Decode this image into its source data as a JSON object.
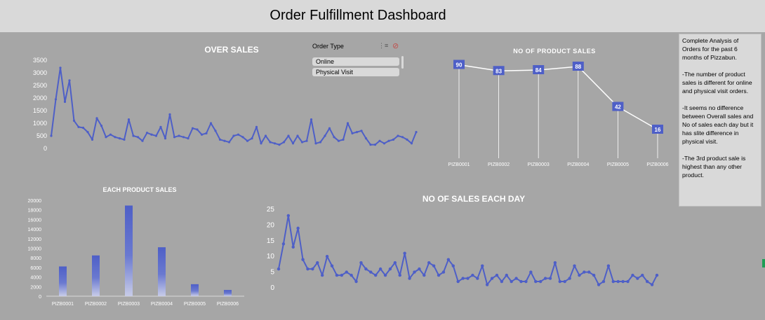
{
  "dashboard": {
    "title": "Order Fulfillment Dashboard"
  },
  "slicer": {
    "header": "Order Type",
    "items": [
      "Online",
      "Physical Visit"
    ]
  },
  "insights": [
    "Complete Analysis of Orders for the past 6 months of Pizzabun.",
    "-The number of product sales is different for online and physical visit orders.",
    "-It seems no difference between Overall sales and No of sales each day but it has slite difference in physical visit.",
    "-The 3rd product sale is highest than any other product."
  ],
  "colors": {
    "series": "#4e5fc7",
    "background": "#a6a6a6",
    "header": "#d9d9d9"
  },
  "chart_data": [
    {
      "id": "over_sales",
      "type": "line",
      "title": "OVER SALES",
      "ylim": [
        0,
        3500
      ],
      "yticks": [
        0,
        500,
        1000,
        1500,
        2000,
        2500,
        3000,
        3500
      ],
      "grid": false,
      "values": [
        500,
        1950,
        3200,
        1850,
        2700,
        1100,
        850,
        820,
        650,
        350,
        1200,
        900,
        450,
        550,
        450,
        400,
        350,
        1150,
        500,
        450,
        300,
        620,
        550,
        500,
        850,
        400,
        1350,
        450,
        500,
        450,
        400,
        800,
        750,
        550,
        600,
        1000,
        700,
        350,
        300,
        250,
        500,
        550,
        450,
        300,
        400,
        850,
        200,
        500,
        250,
        200,
        150,
        250,
        500,
        200,
        500,
        250,
        300,
        1150,
        200,
        250,
        500,
        800,
        450,
        300,
        350,
        1000,
        600,
        650,
        700,
        400,
        150,
        150,
        300,
        200,
        300,
        350,
        500,
        450,
        350,
        200,
        650
      ]
    },
    {
      "id": "no_of_product_sales",
      "type": "line",
      "title": "NO OF PRODUCT SALES",
      "categories": [
        "PIZB0001",
        "PIZB0002",
        "PIZB0003",
        "PIZB0004",
        "PIZB0005",
        "PIZB0006"
      ],
      "values": [
        90,
        83,
        84,
        88,
        42,
        16
      ],
      "ylim": [
        0,
        100
      ]
    },
    {
      "id": "each_product_sales",
      "type": "bar",
      "title": "EACH PRODUCT SALES",
      "categories": [
        "PIZB0001",
        "PIZB0002",
        "PIZB0003",
        "PIZB0004",
        "PIZB0005",
        "PIZB0006"
      ],
      "values": [
        6200,
        8500,
        18900,
        10200,
        2500,
        1300
      ],
      "ylim": [
        0,
        20000
      ],
      "yticks": [
        0,
        2000,
        4000,
        6000,
        8000,
        10000,
        12000,
        14000,
        16000,
        18000,
        20000
      ]
    },
    {
      "id": "no_of_sales_each_day",
      "type": "line",
      "title": "NO OF SALES EACH DAY",
      "ylim": [
        0,
        25
      ],
      "yticks": [
        0,
        5,
        10,
        15,
        20,
        25
      ],
      "values": [
        6,
        14,
        23,
        13,
        19,
        9,
        6,
        6,
        8,
        4,
        10,
        7,
        4,
        4,
        5,
        4,
        2,
        8,
        6,
        5,
        4,
        6,
        4,
        6,
        8,
        4,
        11,
        3,
        5,
        6,
        4,
        8,
        7,
        4,
        5,
        9,
        7,
        2,
        3,
        3,
        4,
        3,
        7,
        1,
        3,
        4,
        2,
        4,
        2,
        3,
        2,
        2,
        5,
        2,
        2,
        3,
        3,
        8,
        2,
        2,
        3,
        7,
        4,
        5,
        5,
        4,
        1,
        2,
        7,
        2,
        2,
        2,
        2,
        4,
        3,
        4,
        2,
        1,
        4
      ]
    }
  ]
}
